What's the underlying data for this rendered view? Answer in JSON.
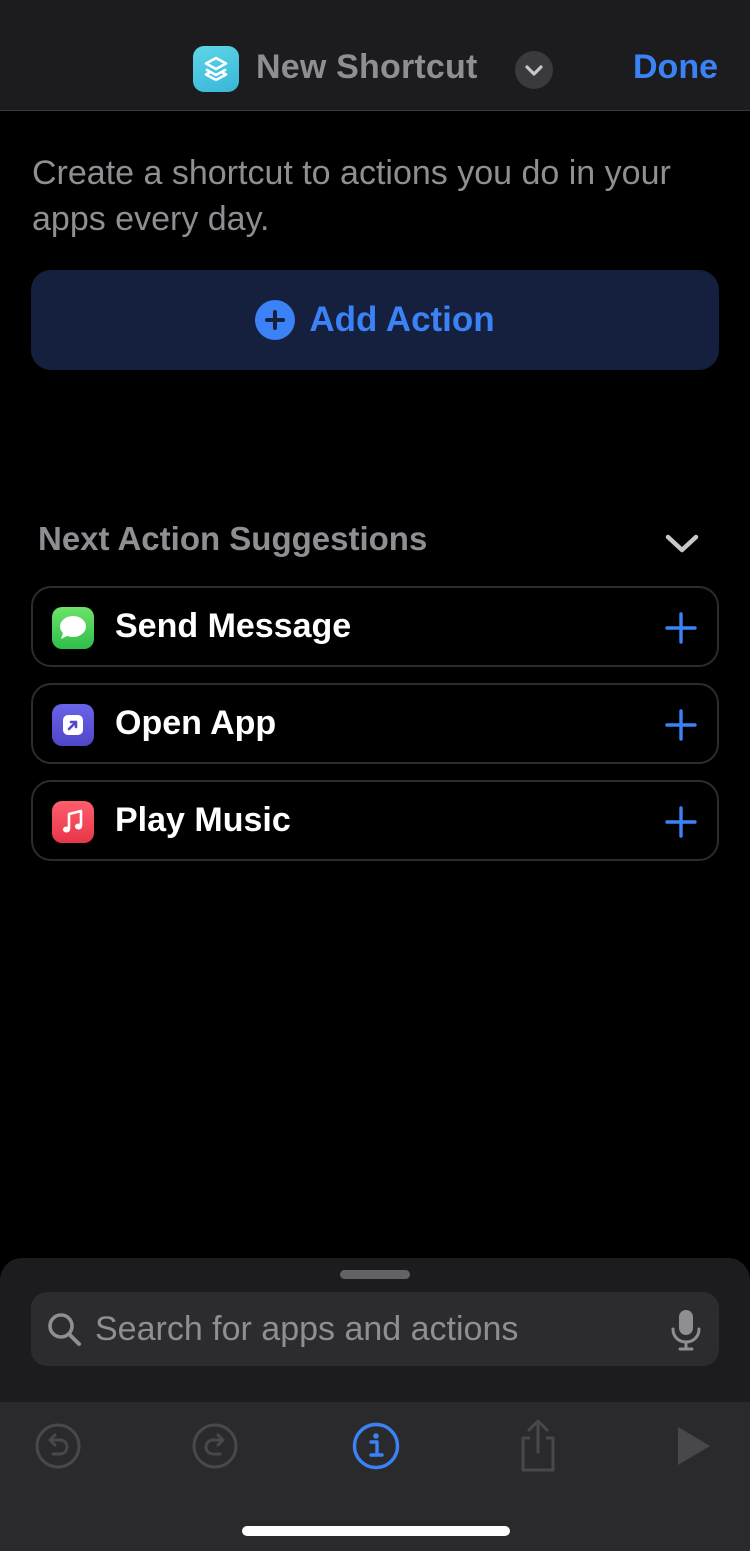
{
  "nav": {
    "title": "New Shortcut",
    "done_label": "Done",
    "app_icon": "shortcuts-icon",
    "title_menu_icon": "chevron-down-icon"
  },
  "intro": {
    "text": "Create a shortcut to actions you do in your apps every day."
  },
  "add_action": {
    "label": "Add Action",
    "icon": "plus-circle-icon"
  },
  "suggestions": {
    "header": "Next Action Suggestions",
    "collapse_icon": "chevron-down-icon",
    "items": [
      {
        "label": "Send Message",
        "icon": "messages-icon",
        "color": "#34c759"
      },
      {
        "label": "Open App",
        "icon": "open-app-icon",
        "color": "#5856d6"
      },
      {
        "label": "Play Music",
        "icon": "music-icon",
        "color": "#fa3f55"
      }
    ]
  },
  "search": {
    "placeholder": "Search for apps and actions",
    "value": "",
    "icon": "search-icon",
    "mic_icon": "microphone-icon"
  },
  "toolbar": {
    "items": [
      "undo-icon",
      "redo-icon",
      "info-icon",
      "share-icon",
      "play-icon"
    ]
  },
  "colors": {
    "accent": "#3b82f6",
    "background": "#000000",
    "surface": "#1c1c1e"
  }
}
